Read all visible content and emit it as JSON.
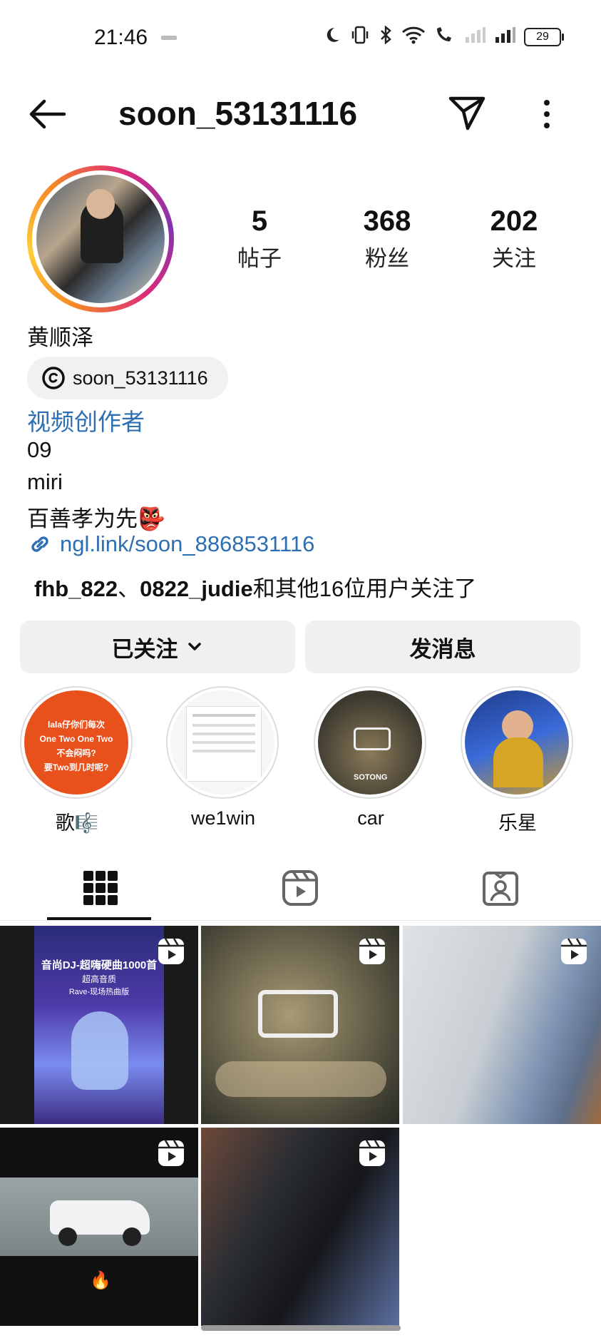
{
  "status": {
    "time": "21:46",
    "battery": "29"
  },
  "header": {
    "title": "soon_53131116"
  },
  "profile": {
    "stats": [
      {
        "value": "5",
        "label": "帖子"
      },
      {
        "value": "368",
        "label": "粉丝"
      },
      {
        "value": "202",
        "label": "关注"
      }
    ],
    "name": "黄顺泽",
    "threads_handle": "soon_53131116",
    "category": "视频创作者",
    "bio": [
      "09",
      "miri",
      "百善孝为先👺"
    ],
    "link": "ngl.link/soon_8868531116",
    "followed_by": {
      "user1": "fhb_822",
      "sep": "、",
      "user2": "0822_judie",
      "rest": "和其他16位用户关注了"
    }
  },
  "buttons": {
    "following": "已关注",
    "message": "发消息"
  },
  "highlights": [
    {
      "label": "歌🎼",
      "text_lines": [
        "lala仔你们每次",
        "One Two One Two",
        "不会闷吗?",
        "要Two到几时呢?"
      ]
    },
    {
      "label": "we1win"
    },
    {
      "label": "car",
      "badge": "SOTONG"
    },
    {
      "label": "乐星"
    }
  ],
  "grid": {
    "post1": {
      "line1": "音尚DJ-超嗨硬曲1000首",
      "line2": "超高音质",
      "line3": "Rave-现场热曲版"
    },
    "post4": {
      "emoji": "🔥"
    }
  },
  "colors": {
    "link": "#2d6fb3",
    "button_bg": "#eff0f2"
  }
}
